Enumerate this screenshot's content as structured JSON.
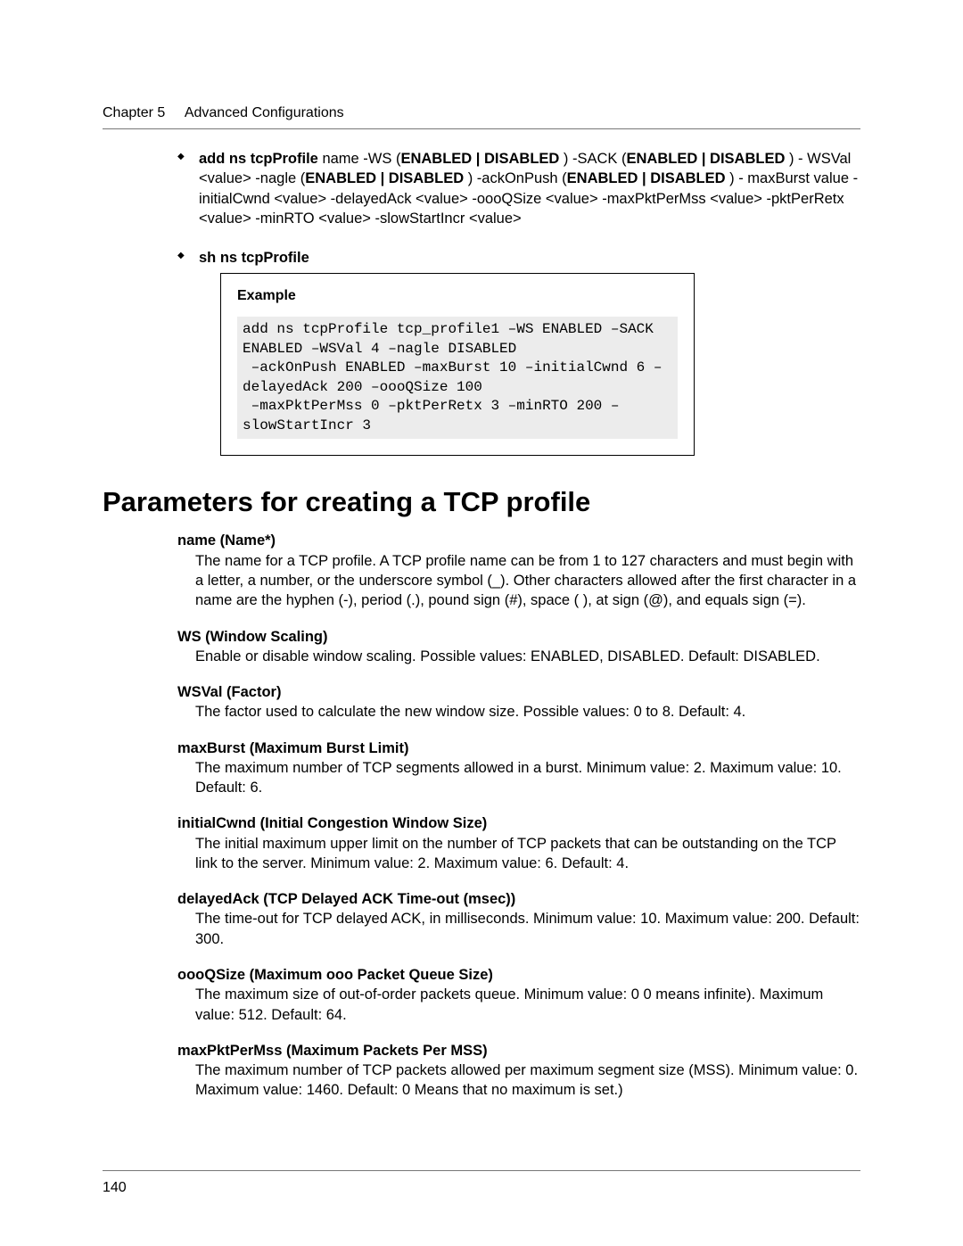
{
  "header": {
    "chapter": "Chapter 5",
    "title": "Advanced Configurations"
  },
  "bullets": {
    "item1": {
      "lead_bold": "add ns tcpProfile",
      "after_lead": " name -WS (",
      "opt1": "ENABLED | DISABLED",
      "mid1": " ) -SACK (",
      "opt2": "ENABLED | DISABLED",
      "mid2": " ) - WSVal <value> -nagle (",
      "opt3": "ENABLED | DISABLED",
      "mid3": " ) -ackOnPush (",
      "opt4": "ENABLED | DISABLED",
      "tail": " ) - maxBurst value -initialCwnd <value> -delayedAck <value> -oooQSize <value> -maxPktPerMss <value> -pktPerRetx <value> -minRTO <value> -slowStartIncr <value>"
    },
    "item2": "sh ns tcpProfile"
  },
  "example": {
    "label": "Example",
    "code": "add ns tcpProfile tcp_profile1 –WS ENABLED –SACK ENABLED –WSVal 4 –nagle DISABLED\n –ackOnPush ENABLED –maxBurst 10 –initialCwnd 6 –delayedAck 200 –oooQSize 100\n –maxPktPerMss 0 –pktPerRetx 3 –minRTO 200 –slowStartIncr 3"
  },
  "section_title": "Parameters for creating a TCP profile",
  "params": [
    {
      "name": "name (Name*)",
      "desc": "The name for a TCP profile. A TCP profile name can be from 1 to 127 characters and must begin with a letter, a number, or the underscore symbol (_). Other characters allowed after the first character in a name are the hyphen (-), period (.), pound sign (#), space ( ), at sign (@), and equals sign (=)."
    },
    {
      "name": "WS (Window Scaling)",
      "desc": "Enable or disable window scaling. Possible values: ENABLED, DISABLED. Default: DISABLED."
    },
    {
      "name": "WSVal (Factor)",
      "desc": "The factor used to calculate the new window size. Possible values: 0 to 8. Default: 4."
    },
    {
      "name": "maxBurst (Maximum Burst Limit)",
      "desc": "The maximum number of TCP segments allowed in a burst. Minimum value: 2. Maximum value: 10. Default: 6."
    },
    {
      "name": "initialCwnd (Initial Congestion Window Size)",
      "desc": "The initial maximum upper limit on the number of TCP packets that can be outstanding on the TCP link to the server. Minimum value: 2. Maximum value: 6. Default: 4."
    },
    {
      "name": "delayedAck (TCP Delayed ACK Time-out (msec))",
      "desc": "The time-out for TCP delayed ACK, in milliseconds. Minimum value: 10. Maximum value: 200. Default: 300."
    },
    {
      "name": "oooQSize (Maximum ooo Packet Queue Size)",
      "desc": "The maximum size of out-of-order packets queue. Minimum value: 0 0 means infinite). Maximum value: 512. Default: 64."
    },
    {
      "name": "maxPktPerMss (Maximum Packets Per MSS)",
      "desc": "The maximum number of TCP packets allowed per maximum segment size (MSS). Minimum value: 0. Maximum value: 1460. Default: 0 Means that no maximum is set.)"
    }
  ],
  "page_number": "140"
}
